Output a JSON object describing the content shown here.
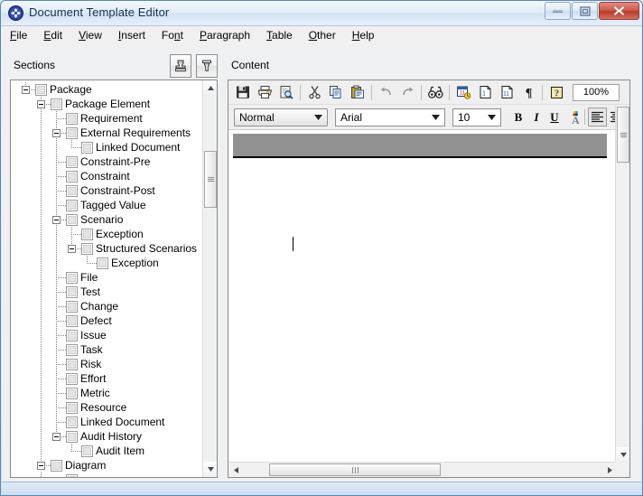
{
  "window": {
    "title": "Document Template Editor",
    "app_icon": "swirl-globe-icon",
    "buttons": {
      "minimize": "minimize-icon",
      "restore": "restore-icon",
      "close": "close-icon"
    }
  },
  "menubar": {
    "items": [
      {
        "label": "File",
        "accel": "F"
      },
      {
        "label": "Edit",
        "accel": "E"
      },
      {
        "label": "View",
        "accel": "V"
      },
      {
        "label": "Insert",
        "accel": "I"
      },
      {
        "label": "Font",
        "accel": "n"
      },
      {
        "label": "Paragraph",
        "accel": "P"
      },
      {
        "label": "Table",
        "accel": "T"
      },
      {
        "label": "Other",
        "accel": "O"
      },
      {
        "label": "Help",
        "accel": "H"
      }
    ]
  },
  "sections_pane": {
    "label": "Sections",
    "tool_buttons": [
      {
        "name": "stamp-insert-icon",
        "tooltip": ""
      },
      {
        "name": "stamp-remove-icon",
        "tooltip": ""
      }
    ],
    "tree": [
      {
        "label": "Package",
        "depth": 0,
        "expander": "minus",
        "checked": false
      },
      {
        "label": "Package Element",
        "depth": 1,
        "expander": "minus",
        "checked": false
      },
      {
        "label": "Requirement",
        "depth": 2,
        "expander": "none",
        "checked": false
      },
      {
        "label": "External Requirements",
        "depth": 2,
        "expander": "minus",
        "checked": false
      },
      {
        "label": "Linked Document",
        "depth": 3,
        "expander": "none",
        "checked": false
      },
      {
        "label": "Constraint-Pre",
        "depth": 2,
        "expander": "none",
        "checked": false
      },
      {
        "label": "Constraint",
        "depth": 2,
        "expander": "none",
        "checked": false
      },
      {
        "label": "Constraint-Post",
        "depth": 2,
        "expander": "none",
        "checked": false
      },
      {
        "label": "Tagged Value",
        "depth": 2,
        "expander": "none",
        "checked": false
      },
      {
        "label": "Scenario",
        "depth": 2,
        "expander": "minus",
        "checked": false
      },
      {
        "label": "Exception",
        "depth": 3,
        "expander": "none",
        "checked": false
      },
      {
        "label": "Structured Scenarios",
        "depth": 3,
        "expander": "minus",
        "checked": false
      },
      {
        "label": "Exception",
        "depth": 4,
        "expander": "none",
        "checked": false
      },
      {
        "label": "File",
        "depth": 2,
        "expander": "none",
        "checked": false
      },
      {
        "label": "Test",
        "depth": 2,
        "expander": "none",
        "checked": false
      },
      {
        "label": "Change",
        "depth": 2,
        "expander": "none",
        "checked": false
      },
      {
        "label": "Defect",
        "depth": 2,
        "expander": "none",
        "checked": false
      },
      {
        "label": "Issue",
        "depth": 2,
        "expander": "none",
        "checked": false
      },
      {
        "label": "Task",
        "depth": 2,
        "expander": "none",
        "checked": false
      },
      {
        "label": "Risk",
        "depth": 2,
        "expander": "none",
        "checked": false
      },
      {
        "label": "Effort",
        "depth": 2,
        "expander": "none",
        "checked": false
      },
      {
        "label": "Metric",
        "depth": 2,
        "expander": "none",
        "checked": false
      },
      {
        "label": "Resource",
        "depth": 2,
        "expander": "none",
        "checked": false
      },
      {
        "label": "Linked Document",
        "depth": 2,
        "expander": "none",
        "checked": false
      },
      {
        "label": "Audit History",
        "depth": 2,
        "expander": "minus",
        "checked": false
      },
      {
        "label": "Audit Item",
        "depth": 3,
        "expander": "none",
        "checked": false
      },
      {
        "label": "Diagram",
        "depth": 1,
        "expander": "minus",
        "checked": false
      }
    ],
    "scrollbar": {
      "up_arrow": "scroll-up-icon",
      "down_arrow": "scroll-down-icon"
    }
  },
  "content_pane": {
    "label": "Content",
    "toolbar_main": [
      {
        "name": "save-icon"
      },
      {
        "name": "print-icon"
      },
      {
        "name": "print-preview-icon"
      },
      {
        "name": "separator"
      },
      {
        "name": "cut-icon"
      },
      {
        "name": "copy-icon"
      },
      {
        "name": "paste-icon"
      },
      {
        "name": "separator"
      },
      {
        "name": "undo-icon"
      },
      {
        "name": "redo-icon"
      },
      {
        "name": "separator"
      },
      {
        "name": "find-icon"
      },
      {
        "name": "separator"
      },
      {
        "name": "insert-date-icon"
      },
      {
        "name": "insert-page-number-icon"
      },
      {
        "name": "insert-page-count-icon"
      },
      {
        "name": "show-formatting-marks-icon"
      },
      {
        "name": "separator"
      },
      {
        "name": "help-icon"
      }
    ],
    "zoom_value": "100%",
    "format_bar": {
      "style_value": "Normal",
      "font_value": "Arial",
      "size_value": "10",
      "bold_label": "B",
      "italic_label": "I",
      "underline_label": "U",
      "text_color_icon": "text-color-icon",
      "align_left_icon": "align-left-icon",
      "align_center_icon": "align-center-icon"
    },
    "document": {
      "header_band": "header-placeholder-band",
      "caret": "text-caret"
    },
    "scrollbars": {
      "v_down_arrow": "scroll-down-icon",
      "h_left_arrow": "scroll-left-icon",
      "h_right_arrow": "scroll-right-icon"
    }
  },
  "colors": {
    "titlebar_accent": "#d3e3f3",
    "close_button": "#b83b2c",
    "header_band": "#919191",
    "pane_bg": "#eff0f1",
    "toolbar_bg": "#f0efef"
  }
}
